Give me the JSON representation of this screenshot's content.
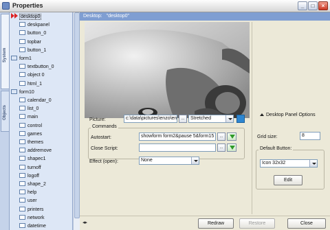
{
  "window": {
    "title": "Properties",
    "buttons": {
      "minimize": "_",
      "maximize": "□",
      "close": "×"
    }
  },
  "tabs": {
    "system": "System",
    "objects": "Objects"
  },
  "tree": {
    "items": [
      {
        "label": "desktop0",
        "level": 0,
        "kind": "red",
        "selected": true
      },
      {
        "label": "deskpanel",
        "level": 1
      },
      {
        "label": "button_0",
        "level": 1
      },
      {
        "label": "topbar",
        "level": 1
      },
      {
        "label": "button_1",
        "level": 1
      },
      {
        "label": "form1",
        "level": 0,
        "kind": "folder"
      },
      {
        "label": "textbutton_0",
        "level": 1
      },
      {
        "label": "object 0",
        "level": 1
      },
      {
        "label": "html_1",
        "level": 1
      },
      {
        "label": "form10",
        "level": 0,
        "kind": "folder"
      },
      {
        "label": "calendar_0",
        "level": 1
      },
      {
        "label": "list_0",
        "level": 1
      },
      {
        "label": "main",
        "level": 1
      },
      {
        "label": "control",
        "level": 1
      },
      {
        "label": "games",
        "level": 1
      },
      {
        "label": "themes",
        "level": 1
      },
      {
        "label": "addremove",
        "level": 1
      },
      {
        "label": "shapec1",
        "level": 1
      },
      {
        "label": "turnoff",
        "level": 1
      },
      {
        "label": "logoff",
        "level": 1
      },
      {
        "label": "shape_2",
        "level": 1
      },
      {
        "label": "help",
        "level": 1
      },
      {
        "label": "user",
        "level": 1
      },
      {
        "label": "printers",
        "level": 1
      },
      {
        "label": "network",
        "level": 1
      },
      {
        "label": "datetime",
        "level": 1
      }
    ]
  },
  "header": {
    "label": "Desktop:",
    "value": "\"desktop0\""
  },
  "picture": {
    "label": "Picture:",
    "path": "c:\\data\\pictures\\enzo\\enz",
    "browse": "...",
    "mode": "Stretched",
    "color": "#2e86d1"
  },
  "commands": {
    "title": "Commands",
    "autostart_label": "Autostart:",
    "autostart_value": "showform form2&pause 5&form15 tr",
    "close_label": "Close Script:",
    "close_value": "",
    "browse": "..."
  },
  "effect": {
    "label": "Effect (open):",
    "value": "None"
  },
  "right_panel": {
    "toggle_label": "Desktop Panel Options",
    "grid_label": "Grid size:",
    "grid_value": "8",
    "default_button_title": "Default Button:",
    "default_button_value": "Icon 32x32",
    "edit_label": "Edit"
  },
  "bottom": {
    "redraw": "Redraw",
    "restore": "Restore",
    "close": "Close",
    "left_icon": "◂▸"
  }
}
